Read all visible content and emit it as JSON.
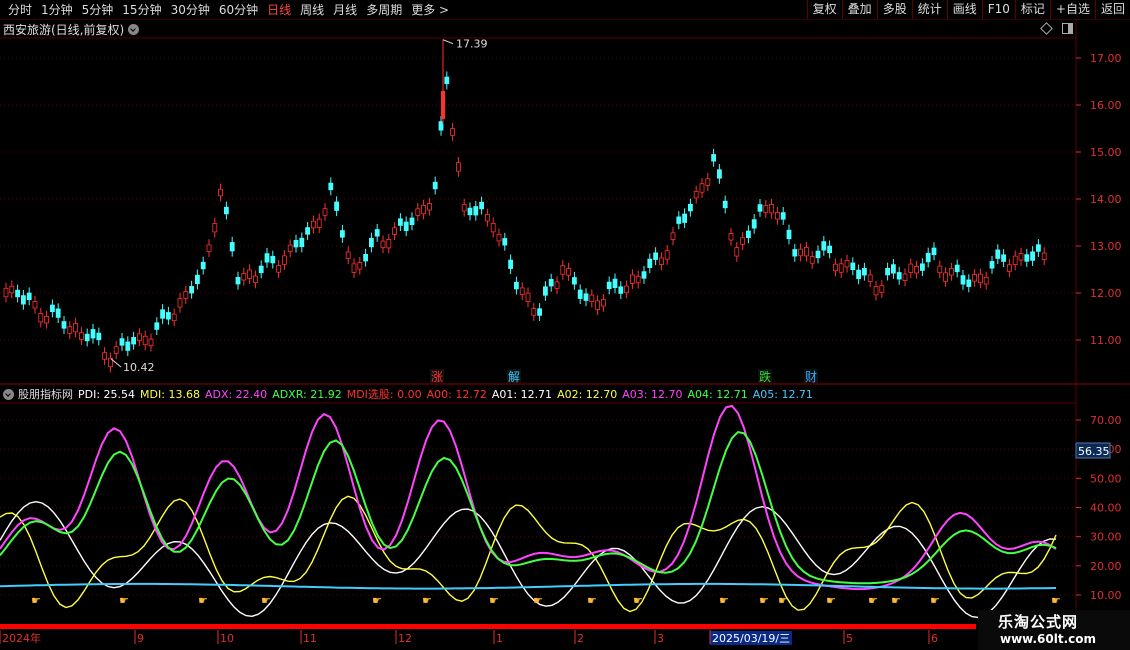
{
  "toolbar": {
    "periods": [
      "分时",
      "1分钟",
      "5分钟",
      "15分钟",
      "30分钟",
      "60分钟",
      "日线",
      "周线",
      "月线",
      "多周期",
      "更多 >"
    ],
    "active_period": "日线",
    "right_buttons": [
      "复权",
      "叠加",
      "多股",
      "统计",
      "画线",
      "F10",
      "标记",
      "+自选",
      "返回"
    ]
  },
  "main_chart": {
    "title": "西安旅游(日线,前复权)",
    "price_axis": [
      "17.00",
      "16.00",
      "15.00",
      "14.00",
      "13.00",
      "12.00",
      "11.00"
    ],
    "high_label": "17.39",
    "low_label": "10.42",
    "event_markers": [
      {
        "text": "涨",
        "color": "#ff3030"
      },
      {
        "text": "解",
        "color": "#33ccff"
      },
      {
        "text": "跌",
        "color": "#33dd33"
      },
      {
        "text": "财",
        "color": "#33aaff"
      }
    ]
  },
  "indicator": {
    "title": "股朋指标网",
    "values": [
      {
        "text": "PDI: 25.54",
        "color": "#ffffff"
      },
      {
        "text": "MDI: 13.68",
        "color": "#ffff44"
      },
      {
        "text": "ADX: 22.40",
        "color": "#ff44ff"
      },
      {
        "text": "ADXR: 21.92",
        "color": "#44ff44"
      },
      {
        "text": "MDI选股: 0.00",
        "color": "#ff3030"
      },
      {
        "text": "A00: 12.72",
        "color": "#ff3030"
      },
      {
        "text": "A01: 12.71",
        "color": "#ffffff"
      },
      {
        "text": "A02: 12.70",
        "color": "#ffff44"
      },
      {
        "text": "A03: 12.70",
        "color": "#ff44ff"
      },
      {
        "text": "A04: 12.71",
        "color": "#44ff44"
      },
      {
        "text": "A05: 12.71",
        "color": "#44ccff"
      }
    ],
    "axis": [
      "70.00",
      "60.00",
      "50.00",
      "40.00",
      "30.00",
      "20.00",
      "10.00"
    ],
    "cursor_value": "56.35"
  },
  "date_axis": {
    "labels": [
      "2024年",
      "9",
      "10",
      "11",
      "12",
      "1",
      "2",
      "3",
      "2025/03/19/三",
      "5",
      "6"
    ]
  },
  "watermark": {
    "name": "乐淘公式网",
    "url": "www.60lt.com"
  },
  "colors": {
    "up": "#ff3030",
    "down": "#44ffff",
    "grid": "#5a0000",
    "pdi": "#ffffff",
    "mdi": "#ffff44",
    "adx": "#ff44ff",
    "adxr": "#44ff44",
    "base": "#44ccff"
  }
}
